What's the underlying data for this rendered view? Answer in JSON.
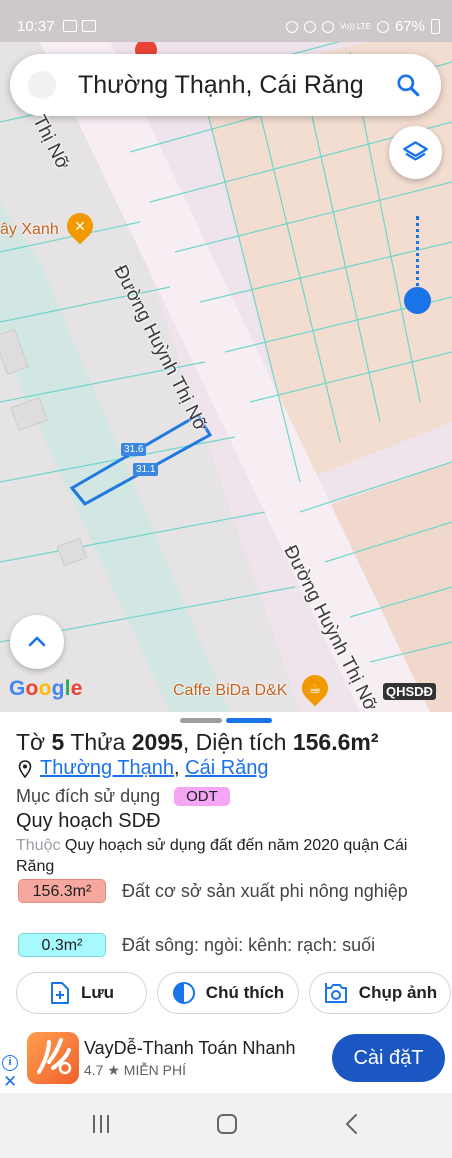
{
  "status_bar": {
    "time": "10:37",
    "network": "Vo)) LTE",
    "battery": "67%"
  },
  "map": {
    "search": {
      "query": "Thường Thạnh, Cái Răng"
    },
    "road_label": "Đường Huỳnh Thị Nỡ",
    "road_label_top": "Thị Nỡ",
    "poi_top": "ây Xanh",
    "poi_bottom": "Caffe BiDa D&K",
    "plot_tag_top": "31.6",
    "plot_tag_bottom": "31.1",
    "overlay_badge": "QHSDĐ",
    "google_logo": {
      "g1": "G",
      "o1": "o",
      "o2": "o",
      "g2": "g",
      "l": "l",
      "e": "e"
    },
    "icons": [
      "home-icon",
      "search-icon",
      "layers-icon",
      "chevron-up-icon",
      "restaurant-icon",
      "coffee-icon"
    ]
  },
  "parcel": {
    "to_label": "Tờ",
    "to_value": "5",
    "thua_label": "Thửa",
    "thua_value": "2095",
    "area_label": ", Diện tích",
    "area_value": "156.6m²",
    "ward": "Thường Thạnh",
    "district": "Cái Răng",
    "separator": ",",
    "purpose_label": "Mục đích sử dụng",
    "purpose_badge": "ODT",
    "planning_title": "Quy hoạch SDĐ",
    "planning_prefix": "Thuộc",
    "planning_desc": "Quy hoạch sử dụng đất đến năm 2020 quận Cái Răng",
    "usage": [
      {
        "area": "156.3m²",
        "desc": "Đất cơ sở sản xuất phi nông nghiệp",
        "color": "#f6a79e"
      },
      {
        "area": "0.3m²",
        "desc": "Đất sông: ngòi: kênh: rạch: suối",
        "color": "#a6fafd"
      }
    ]
  },
  "actions": {
    "save": "Lưu",
    "legend": "Chú thích",
    "screenshot": "Chụp ảnh"
  },
  "ad": {
    "info": "i",
    "close": "✕",
    "app_name": "VayDễ-Thanh Toán Nhanh",
    "app_meta": "4.7 ★ MIỄN PHÍ",
    "install": "Cài đặT"
  },
  "colors": {
    "accent": "#1a73e8",
    "purpose_badge": "#f3a6f3",
    "install_button": "#1a57c2"
  }
}
